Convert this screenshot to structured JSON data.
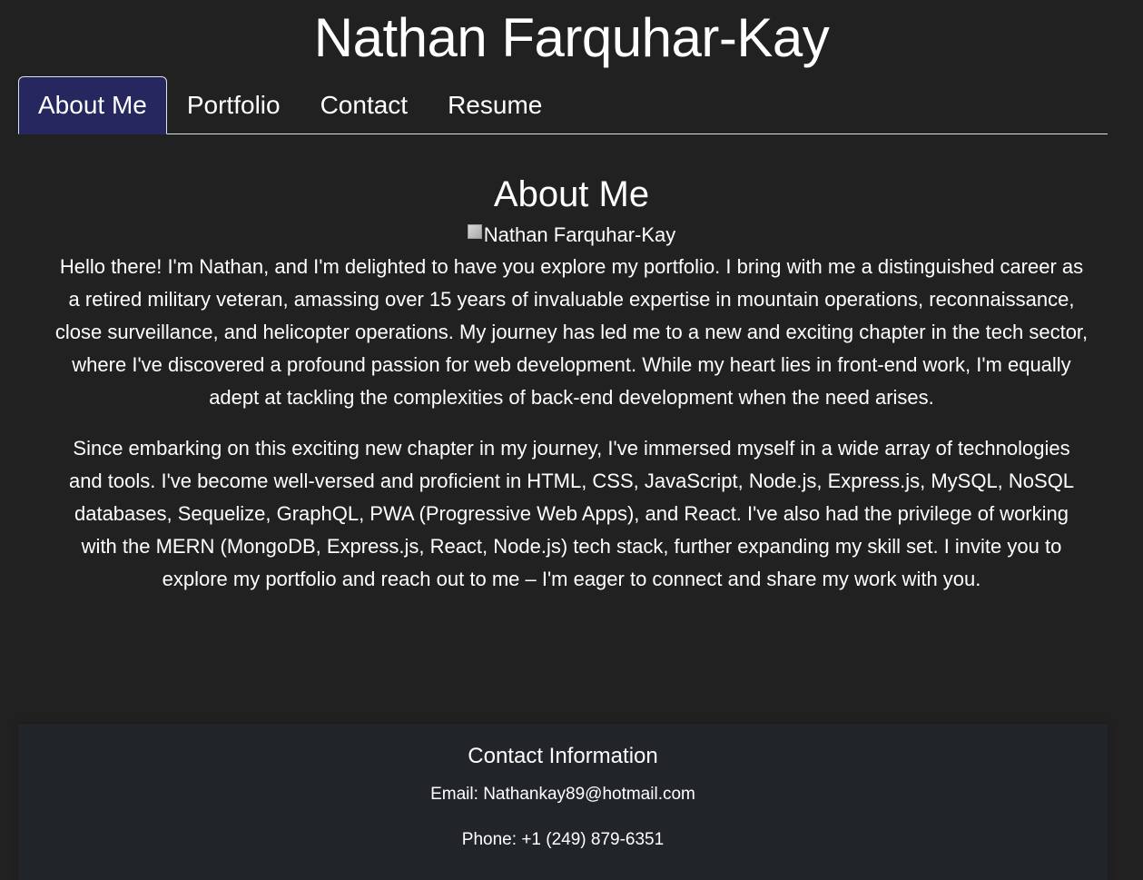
{
  "header": {
    "title": "Nathan Farquhar-Kay"
  },
  "nav": {
    "tabs": [
      {
        "label": "About Me",
        "active": true
      },
      {
        "label": "Portfolio",
        "active": false
      },
      {
        "label": "Contact",
        "active": false
      },
      {
        "label": "Resume",
        "active": false
      }
    ]
  },
  "about": {
    "heading": "About Me",
    "image_alt": "Nathan Farquhar-Kay",
    "paragraphs": [
      "Hello there! I'm Nathan, and I'm delighted to have you explore my portfolio. I bring with me a distinguished career as a retired military veteran, amassing over 15 years of invaluable expertise in mountain operations, reconnaissance, close surveillance, and helicopter operations. My journey has led me to a new and exciting chapter in the tech sector, where I've discovered a profound passion for web development. While my heart lies in front-end work, I'm equally adept at tackling the complexities of back-end development when the need arises.",
      "Since embarking on this exciting new chapter in my journey, I've immersed myself in a wide array of technologies and tools. I've become well-versed and proficient in HTML, CSS, JavaScript, Node.js, Express.js, MySQL, NoSQL databases, Sequelize, GraphQL, PWA (Progressive Web Apps), and React. I've also had the privilege of working with the MERN (MongoDB, Express.js, React, Node.js) tech stack, further expanding my skill set. I invite you to explore my portfolio and reach out to me – I'm eager to connect and share my work with you."
    ]
  },
  "footer": {
    "title": "Contact Information",
    "email_label": "Email:",
    "email": "Nathankay89@hotmail.com",
    "phone_label": "Phone:",
    "phone": "+1 (249) 879-6351"
  },
  "colors": {
    "background": "#212121",
    "active_tab": "#26275f",
    "footer_background": "#212429",
    "text": "#ffffff"
  }
}
